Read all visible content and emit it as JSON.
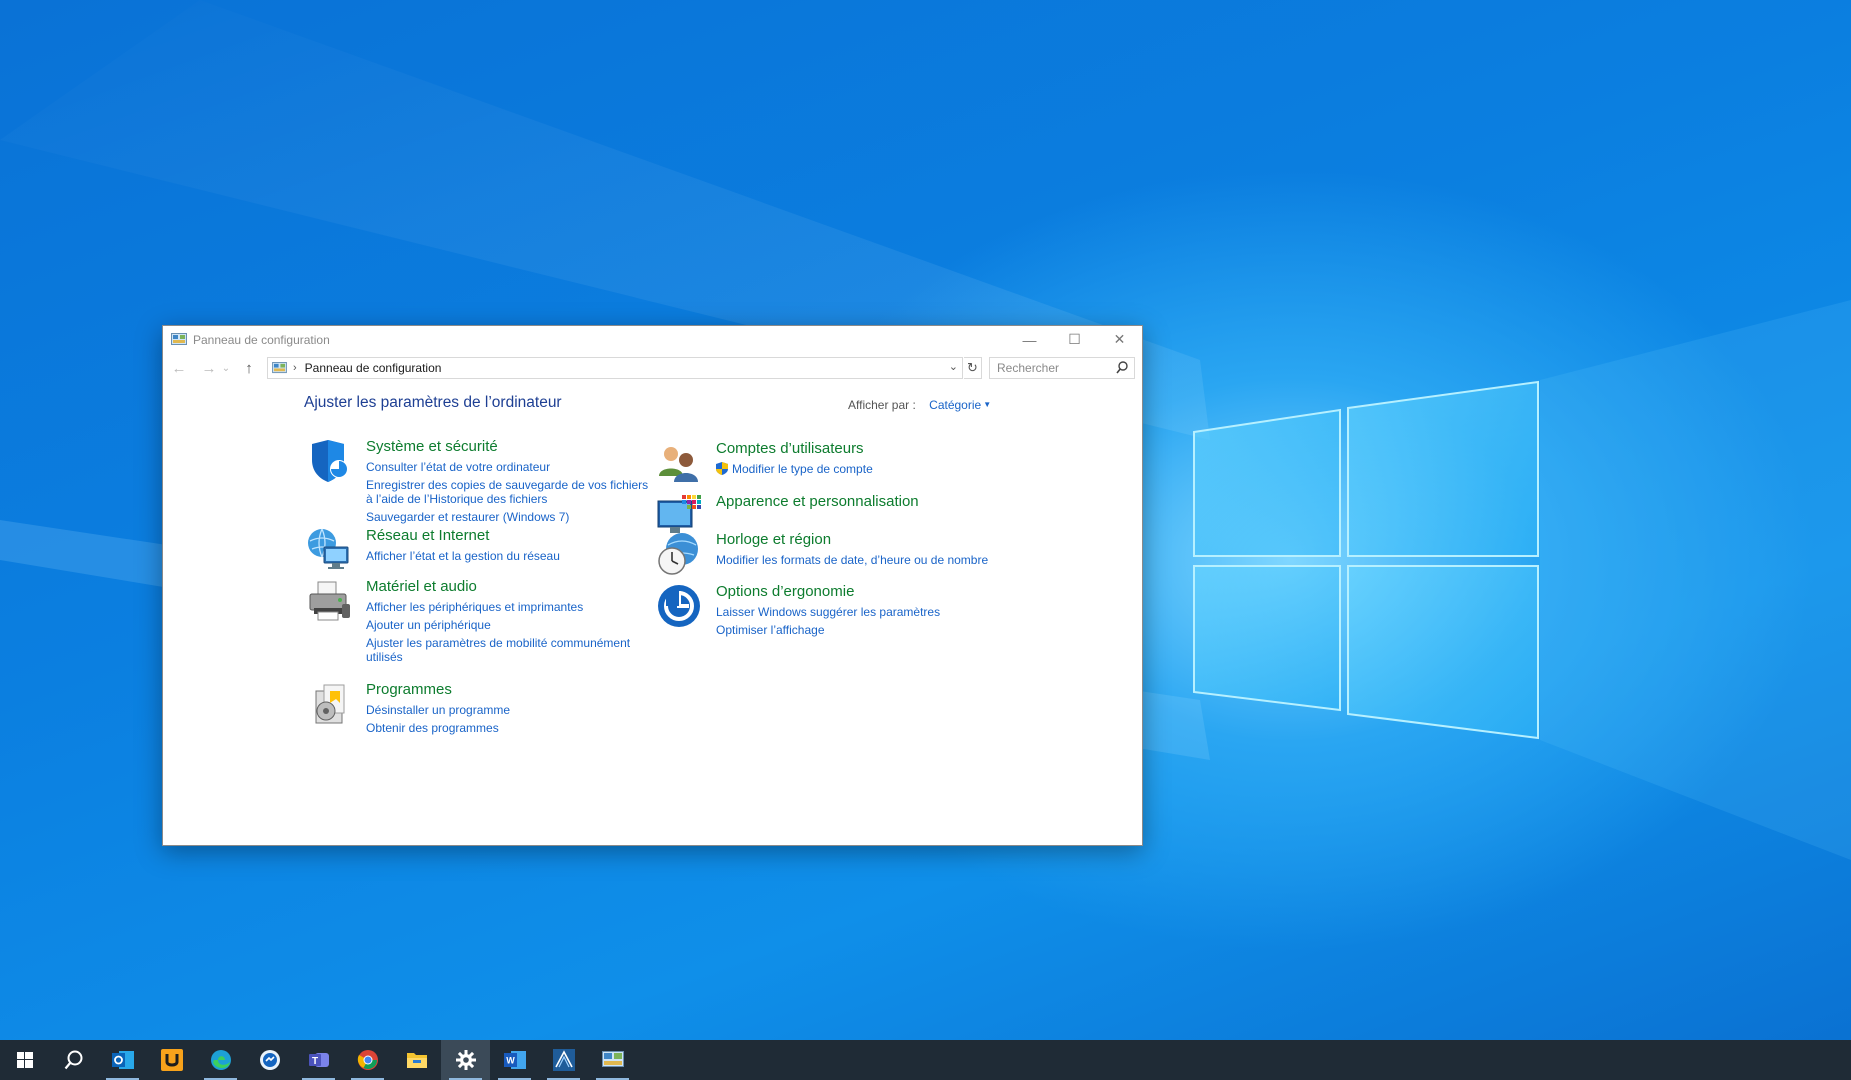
{
  "window": {
    "title": "Panneau de configuration",
    "controls": {
      "minimize": "—",
      "maximize": "☐",
      "close": "✕"
    }
  },
  "address": {
    "back": "←",
    "forward": "→",
    "recent": "⌄",
    "up": "↑",
    "path": "Panneau de configuration",
    "separator": "›",
    "dropdown": "⌄",
    "refresh": "↻"
  },
  "search": {
    "placeholder": "Rechercher"
  },
  "content": {
    "heading": "Ajuster les paramètres de l’ordinateur",
    "view_by_label": "Afficher par :",
    "view_by_value": "Catégorie",
    "categories": [
      {
        "title": "Système et sécurité",
        "icon": "shield-icon",
        "links": [
          "Consulter l’état de votre ordinateur",
          "Enregistrer des copies de sauvegarde de vos fichiers à l’aide de l’Historique des fichiers",
          "Sauvegarder et restaurer (Windows 7)"
        ]
      },
      {
        "title": "Réseau et Internet",
        "icon": "network-icon",
        "links": [
          "Afficher l’état et la gestion du réseau"
        ]
      },
      {
        "title": "Matériel et audio",
        "icon": "printer-icon",
        "links": [
          "Afficher les périphériques et imprimantes",
          "Ajouter un périphérique",
          "Ajuster les paramètres de mobilité communément utilisés"
        ]
      },
      {
        "title": "Programmes",
        "icon": "programs-icon",
        "links": [
          "Désinstaller un programme",
          "Obtenir des programmes"
        ]
      },
      {
        "title": "Comptes d’utilisateurs",
        "icon": "users-icon",
        "links": [
          "Modifier le type de compte"
        ]
      },
      {
        "title": "Apparence et personnalisation",
        "icon": "appearance-icon",
        "links": []
      },
      {
        "title": "Horloge et région",
        "icon": "clock-globe-icon",
        "links": [
          "Modifier les formats de date, d’heure ou de nombre"
        ]
      },
      {
        "title": "Options d’ergonomie",
        "icon": "ease-of-access-icon",
        "links": [
          "Laisser Windows suggérer les paramètres",
          "Optimiser l’affichage"
        ]
      }
    ]
  },
  "taskbar": {
    "items": [
      "start-icon",
      "search-icon",
      "outlook-icon",
      "uplay-icon",
      "edge-icon",
      "messenger-icon",
      "teams-icon",
      "chrome-icon",
      "file-explorer-icon",
      "settings-icon",
      "word-icon",
      "app-icon",
      "control-panel-icon"
    ],
    "active": "settings-icon"
  },
  "colors": {
    "category_title": "#0d7c2e",
    "link": "#1a64c8",
    "heading": "#1e3f93",
    "taskbar": "#1f2b36"
  }
}
